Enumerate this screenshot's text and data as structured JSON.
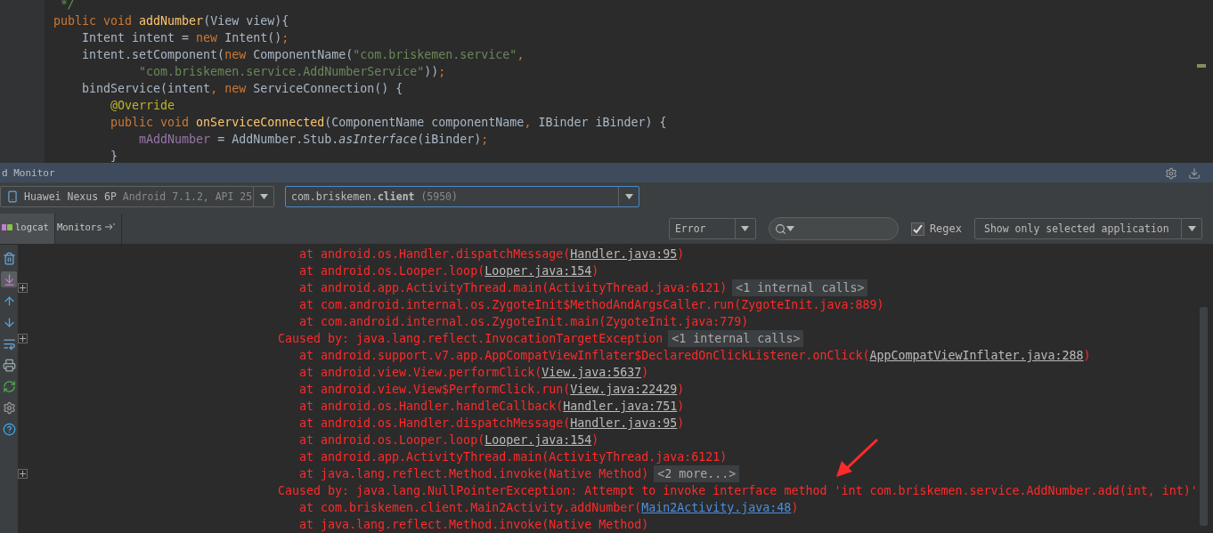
{
  "editor": {
    "lines": [
      [
        {
          "kind": "comment",
          "text": " */"
        }
      ],
      [
        {
          "kind": "keyword",
          "text": "public void "
        },
        {
          "kind": "method",
          "text": "addNumber"
        },
        {
          "kind": "plain",
          "text": "(View view){"
        }
      ],
      [
        {
          "kind": "plain",
          "text": "    Intent intent = "
        },
        {
          "kind": "keyword",
          "text": "new "
        },
        {
          "kind": "plain",
          "text": "Intent()"
        },
        {
          "kind": "keyword",
          "text": ";"
        }
      ],
      [
        {
          "kind": "plain",
          "text": "    intent.setComponent("
        },
        {
          "kind": "keyword",
          "text": "new "
        },
        {
          "kind": "plain",
          "text": "ComponentName("
        },
        {
          "kind": "string",
          "text": "\"com.briskemen.service\""
        },
        {
          "kind": "keyword",
          "text": ","
        }
      ],
      [
        {
          "kind": "string",
          "text": "            \"com.briskemen.service.AddNumberService\""
        },
        {
          "kind": "plain",
          "text": "))"
        },
        {
          "kind": "keyword",
          "text": ";"
        }
      ],
      [
        {
          "kind": "plain",
          "text": "    bindService(intent"
        },
        {
          "kind": "keyword",
          "text": ", new "
        },
        {
          "kind": "plain",
          "text": "ServiceConnection() {"
        }
      ],
      [
        {
          "kind": "annotation",
          "text": "        @Override"
        }
      ],
      [
        {
          "kind": "keyword",
          "text": "        public void "
        },
        {
          "kind": "method",
          "text": "onServiceConnected"
        },
        {
          "kind": "plain",
          "text": "(ComponentName componentName"
        },
        {
          "kind": "keyword",
          "text": ", "
        },
        {
          "kind": "plain",
          "text": "IBinder iBinder) {"
        }
      ],
      [
        {
          "kind": "field",
          "text": "            mAddNumber"
        },
        {
          "kind": "plain",
          "text": " = AddNumber.Stub."
        },
        {
          "kind": "italic",
          "text": "asInterface"
        },
        {
          "kind": "plain",
          "text": "(iBinder)"
        },
        {
          "kind": "keyword",
          "text": ";"
        }
      ],
      [
        {
          "kind": "plain",
          "text": "        }"
        }
      ]
    ]
  },
  "monitor": {
    "title": "d Monitor",
    "device": {
      "name": "Huawei Nexus 6P",
      "detail": "Android 7.1.2, API 25"
    },
    "process": {
      "name": "com.briskemen.**client**",
      "pid": "(5950)"
    },
    "tabs": [
      {
        "label": "logcat",
        "selected": true
      },
      {
        "label": "Monitors",
        "selected": false
      }
    ],
    "level": "Error",
    "regex": {
      "label": "Regex",
      "checked": true
    },
    "filter": "Show only selected application",
    "log": [
      {
        "kind": "frame",
        "fold_marker": false,
        "segments": [
          {
            "kind": "text",
            "text": "at android.os.Handler.dispatchMessage("
          },
          {
            "kind": "link",
            "text": "Handler.java:95"
          },
          {
            "kind": "text",
            "text": ")"
          }
        ]
      },
      {
        "kind": "frame",
        "fold_marker": false,
        "segments": [
          {
            "kind": "text",
            "text": "at android.os.Looper.loop("
          },
          {
            "kind": "link",
            "text": "Looper.java:154"
          },
          {
            "kind": "text",
            "text": ")"
          }
        ]
      },
      {
        "kind": "frame",
        "fold_marker": true,
        "segments": [
          {
            "kind": "text",
            "text": "at android.app.ActivityThread.main(ActivityThread.java:6121)"
          },
          {
            "kind": "badge",
            "text": "<1 internal calls>"
          }
        ]
      },
      {
        "kind": "frame",
        "fold_marker": false,
        "segments": [
          {
            "kind": "text",
            "text": "at com.android.internal.os.ZygoteInit$MethodAndArgsCaller.run(ZygoteInit.java:889)"
          }
        ]
      },
      {
        "kind": "frame",
        "fold_marker": false,
        "segments": [
          {
            "kind": "text",
            "text": "at com.android.internal.os.ZygoteInit.main(ZygoteInit.java:779)"
          }
        ]
      },
      {
        "kind": "cause",
        "fold_marker": true,
        "segments": [
          {
            "kind": "text",
            "text": "Caused by: java.lang.reflect.InvocationTargetException"
          },
          {
            "kind": "badge",
            "text": "<1 internal calls>"
          }
        ]
      },
      {
        "kind": "frame",
        "fold_marker": false,
        "segments": [
          {
            "kind": "text",
            "text": "at android.support.v7.app.AppCompatViewInflater$DeclaredOnClickListener.onClick("
          },
          {
            "kind": "link",
            "text": "AppCompatViewInflater.java:288"
          },
          {
            "kind": "text",
            "text": ")"
          }
        ]
      },
      {
        "kind": "frame",
        "fold_marker": false,
        "segments": [
          {
            "kind": "text",
            "text": "at android.view.View.performClick("
          },
          {
            "kind": "link",
            "text": "View.java:5637"
          },
          {
            "kind": "text",
            "text": ")"
          }
        ]
      },
      {
        "kind": "frame",
        "fold_marker": false,
        "segments": [
          {
            "kind": "text",
            "text": "at android.view.View$PerformClick.run("
          },
          {
            "kind": "link",
            "text": "View.java:22429"
          },
          {
            "kind": "text",
            "text": ")"
          }
        ]
      },
      {
        "kind": "frame",
        "fold_marker": false,
        "segments": [
          {
            "kind": "text",
            "text": "at android.os.Handler.handleCallback("
          },
          {
            "kind": "link",
            "text": "Handler.java:751"
          },
          {
            "kind": "text",
            "text": ")"
          }
        ]
      },
      {
        "kind": "frame",
        "fold_marker": false,
        "segments": [
          {
            "kind": "text",
            "text": "at android.os.Handler.dispatchMessage("
          },
          {
            "kind": "link",
            "text": "Handler.java:95"
          },
          {
            "kind": "text",
            "text": ")"
          }
        ]
      },
      {
        "kind": "frame",
        "fold_marker": false,
        "segments": [
          {
            "kind": "text",
            "text": "at android.os.Looper.loop("
          },
          {
            "kind": "link",
            "text": "Looper.java:154"
          },
          {
            "kind": "text",
            "text": ")"
          }
        ]
      },
      {
        "kind": "frame",
        "fold_marker": false,
        "segments": [
          {
            "kind": "text",
            "text": "at android.app.ActivityThread.main(ActivityThread.java:6121)"
          }
        ]
      },
      {
        "kind": "frame",
        "fold_marker": true,
        "segments": [
          {
            "kind": "text",
            "text": "at java.lang.reflect.Method.invoke(Native Method)"
          },
          {
            "kind": "badge",
            "text": "<2 more...>"
          }
        ]
      },
      {
        "kind": "cause",
        "fold_marker": false,
        "segments": [
          {
            "kind": "text",
            "text": "Caused by: java.lang.NullPointerException: Attempt to invoke interface method 'int com.briskemen.service.AddNumber.add(int, int)'"
          }
        ]
      },
      {
        "kind": "frame",
        "fold_marker": false,
        "segments": [
          {
            "kind": "text",
            "text": "at com.briskemen.client.Main2Activity.addNumber("
          },
          {
            "kind": "project_link",
            "text": "Main2Activity.java:48"
          },
          {
            "kind": "text",
            "text": ")"
          }
        ]
      },
      {
        "kind": "frame",
        "fold_marker": false,
        "segments": [
          {
            "kind": "text",
            "text": "at java.lang.reflect.Method.invoke(Native Method)"
          }
        ]
      }
    ]
  }
}
